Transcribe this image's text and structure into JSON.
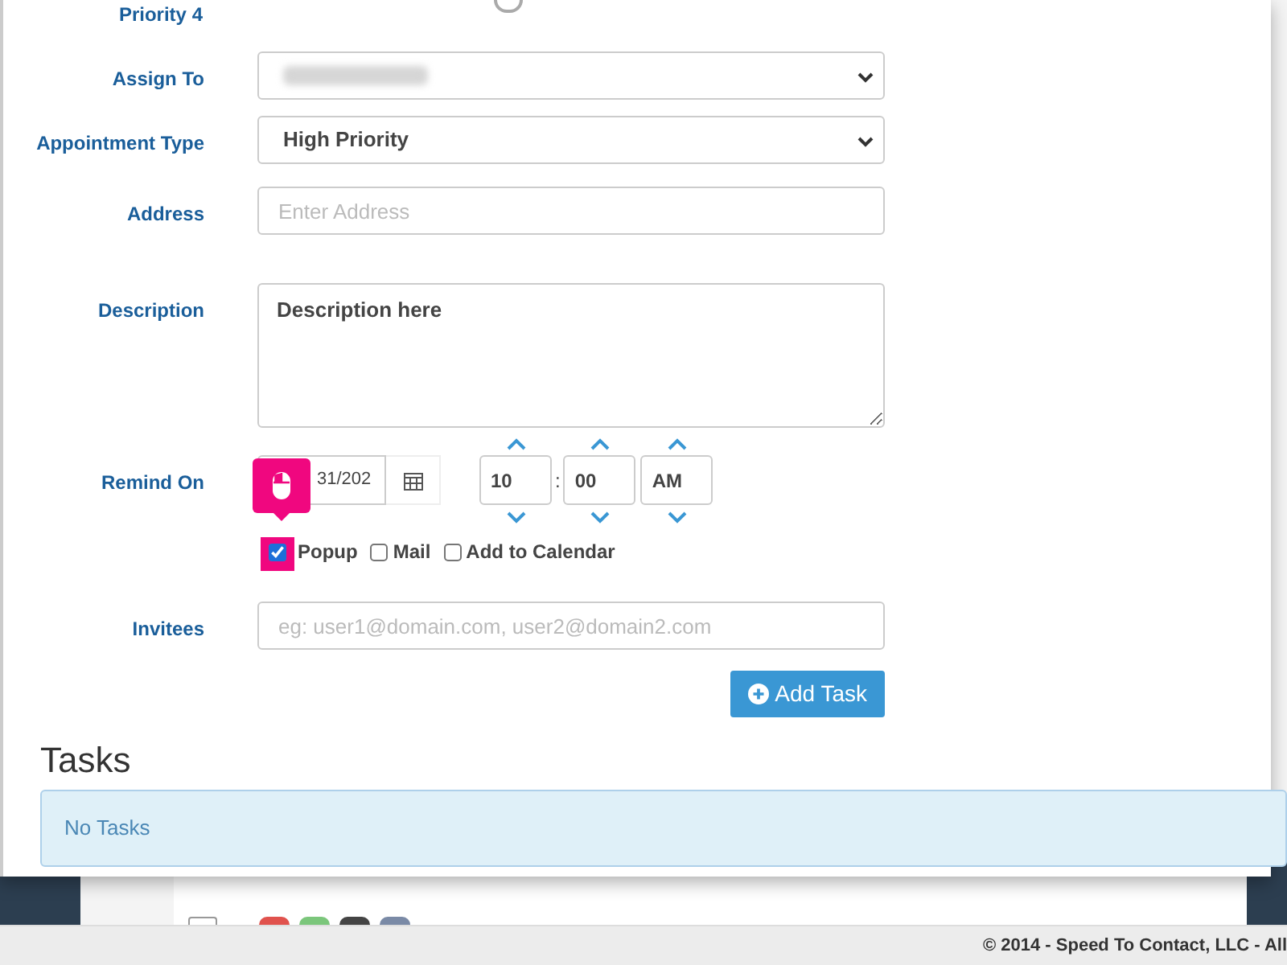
{
  "form": {
    "priority": {
      "label": "Priority 4",
      "selected": false
    },
    "fields": [
      {
        "kind": "select",
        "label": "Assign To",
        "redacted": true
      },
      {
        "kind": "select",
        "label": "Appointment Type",
        "value": "High Priority"
      },
      {
        "kind": "text",
        "label": "Address",
        "placeholder": "Enter Address"
      },
      {
        "kind": "textarea",
        "label": "Description",
        "value": "Description here"
      },
      {
        "kind": "remind",
        "label": "Remind On",
        "date": "31/202",
        "hour": "10",
        "separator": ":",
        "minute": "00",
        "period": "AM",
        "options": [
          {
            "label": "Popup",
            "checked": true,
            "highlighted": true
          },
          {
            "label": "Mail",
            "checked": false,
            "highlighted": false
          },
          {
            "label": "Add to Calendar",
            "checked": false,
            "highlighted": false
          }
        ]
      },
      {
        "kind": "text",
        "label": "Invitees",
        "placeholder": "eg: user1@domain.com, user2@domain2.com"
      }
    ],
    "submit": "Add Task"
  },
  "tasks": {
    "title": "Tasks",
    "empty_message": "No Tasks"
  },
  "background_table": {
    "rows": [
      {
        "checked": false
      }
    ]
  },
  "footer": "© 2014 - Speed To Contact, LLC - All"
}
